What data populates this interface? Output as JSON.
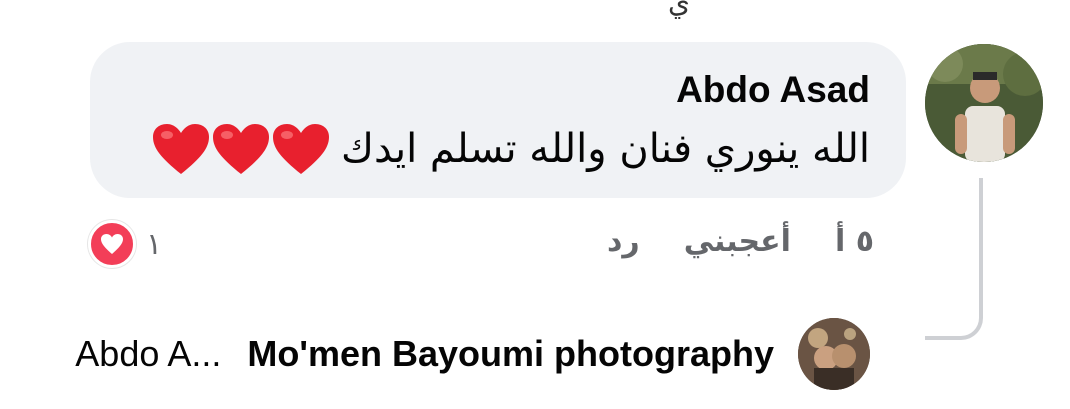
{
  "top_fragment": "ي",
  "comment": {
    "author": "Abdo Asad",
    "text": "الله ينوري فنان والله تسلم ايدك",
    "emoji_icons": [
      "heart-icon",
      "heart-icon",
      "heart-icon"
    ],
    "heart_color": "#e8202e"
  },
  "actions": {
    "time": "٥ أ",
    "like_label": "أعجبني",
    "reply_label": "رد"
  },
  "reactions": {
    "icon": "love-reaction-icon",
    "count": "١",
    "color": "#f33e58"
  },
  "reply_preview": {
    "author": "Mo'men Bayoumi photography",
    "snippet": "Abdo A..."
  },
  "colors": {
    "bubble_bg": "#f0f2f5",
    "secondary_text": "#65676b",
    "thread_line": "#ced0d4"
  }
}
